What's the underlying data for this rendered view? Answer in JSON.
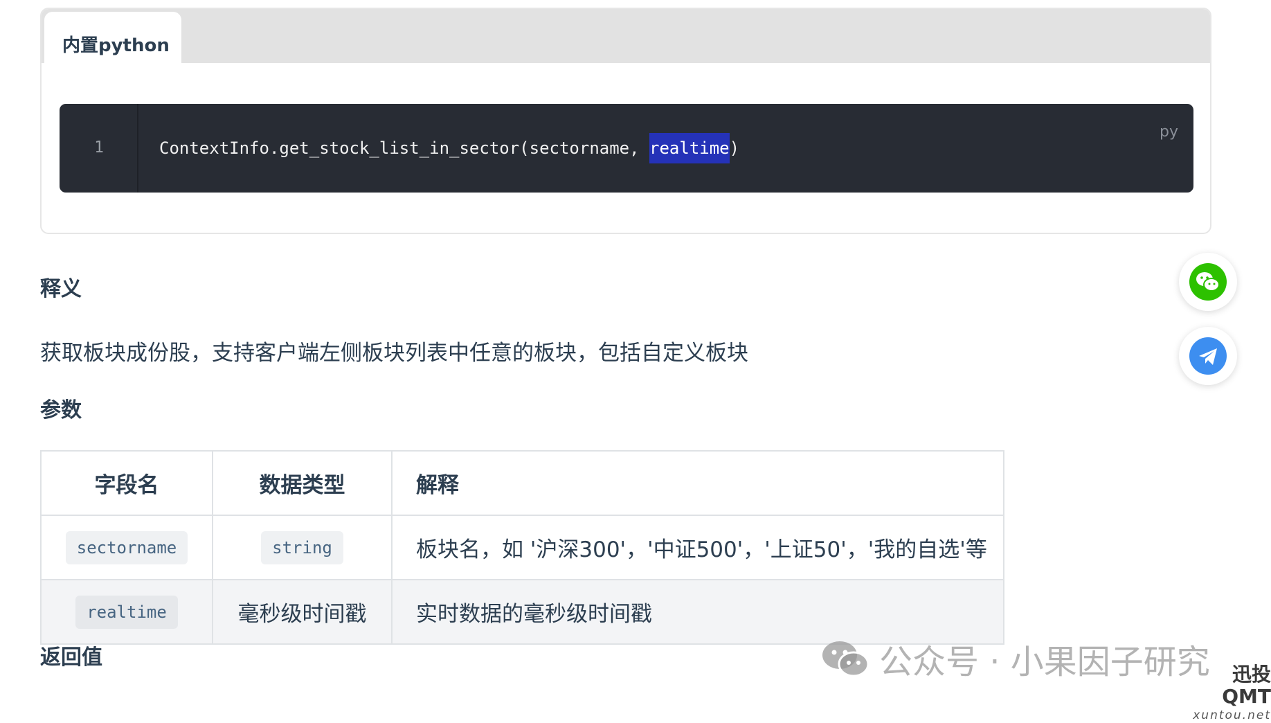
{
  "code_tabs": {
    "active_tab": "内置python",
    "line_number": "1",
    "code_before": "ContextInfo.get_stock_list_in_sector(sectorname, ",
    "code_selected": "realtime",
    "code_after": ")",
    "lang": "py"
  },
  "sections": {
    "meaning_title": "释义",
    "description": "获取板块成份股，支持客户端左侧板块列表中任意的板块，包括自定义板块",
    "params_title": "参数",
    "return_title": "返回值"
  },
  "params_table": {
    "headers": [
      "字段名",
      "数据类型",
      "解释"
    ],
    "rows": [
      {
        "field": "sectorname",
        "type": "string",
        "desc": "板块名，如 '沪深300'，'中证500'，'上证50'，'我的自选'等"
      },
      {
        "field": "realtime",
        "type": "毫秒级时间戳",
        "desc": "实时数据的毫秒级时间戳"
      }
    ]
  },
  "float_buttons": {
    "wechat_icon": "wechat-icon",
    "telegram_icon": "telegram-icon",
    "wechat_color": "#2dc100",
    "telegram_color": "#3d8ef0"
  },
  "watermark": {
    "text": "公众号 · 小果因子研究",
    "brand_name": "迅投QMT",
    "brand_url": "xuntou.net"
  }
}
